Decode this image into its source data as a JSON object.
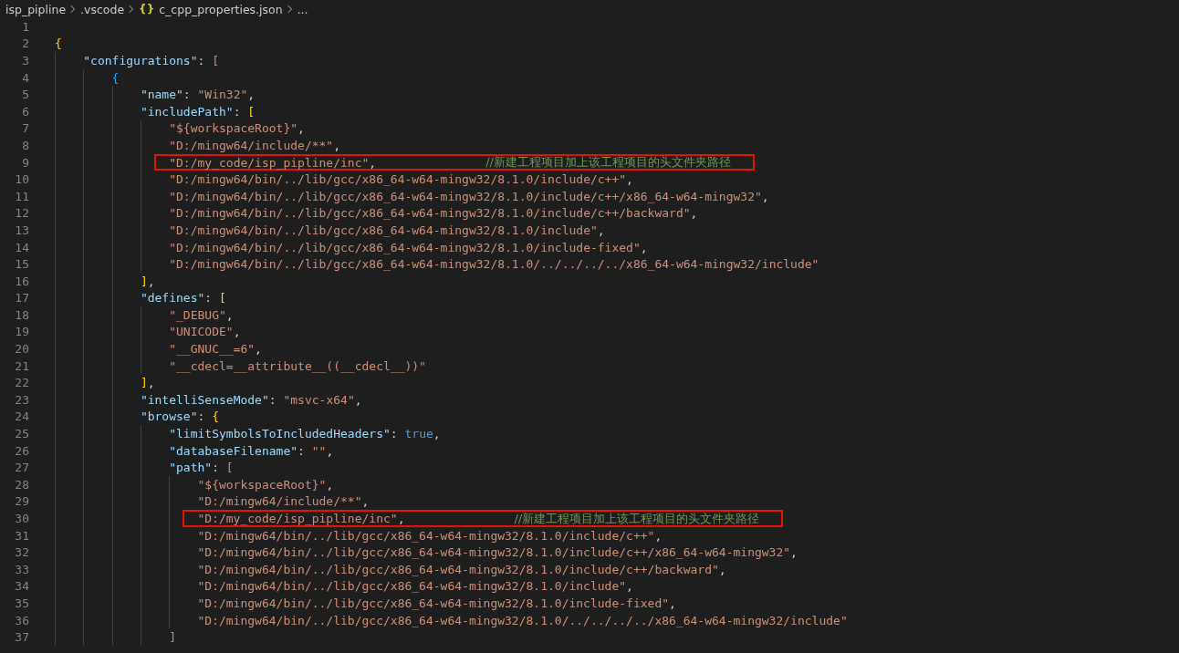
{
  "breadcrumb": {
    "folder": "isp_pipline",
    "subfolder": ".vscode",
    "file_icon": "{}",
    "file": "c_cpp_properties.json",
    "more": "..."
  },
  "lines": [
    {
      "n": "1"
    },
    {
      "n": "2",
      "tokens": [
        {
          "kind": "bracket",
          "text": "{"
        }
      ],
      "children": [
        {
          "n": "3",
          "tokens": [
            {
              "kind": "key",
              "text": "\"configurations\""
            },
            {
              "kind": "punct",
              "text": ": "
            },
            {
              "kind": "bracket",
              "text": "["
            }
          ],
          "children": [
            {
              "n": "4",
              "tokens": [
                {
                  "kind": "bracket",
                  "text": "{"
                }
              ],
              "children": [
                {
                  "n": "5",
                  "tokens": [
                    {
                      "kind": "key",
                      "text": "\"name\""
                    },
                    {
                      "kind": "punct",
                      "text": ": "
                    },
                    {
                      "kind": "string",
                      "text": "\"Win32\""
                    },
                    {
                      "kind": "punct",
                      "text": ","
                    }
                  ]
                },
                {
                  "n": "6",
                  "tokens": [
                    {
                      "kind": "key",
                      "text": "\"includePath\""
                    },
                    {
                      "kind": "punct",
                      "text": ": "
                    },
                    {
                      "kind": "bracket",
                      "text": "["
                    }
                  ],
                  "children": [
                    {
                      "n": "7",
                      "tokens": [
                        {
                          "kind": "string",
                          "text": "\"${workspaceRoot}\""
                        },
                        {
                          "kind": "punct",
                          "text": ","
                        }
                      ]
                    },
                    {
                      "n": "8",
                      "tokens": [
                        {
                          "kind": "string",
                          "text": "\"D:/mingw64/include/**\""
                        },
                        {
                          "kind": "punct",
                          "text": ","
                        }
                      ]
                    },
                    {
                      "n": "9",
                      "highlighted": true,
                      "tokens": [
                        {
                          "kind": "string",
                          "text": "\"D:/my_code/isp_pipline/inc\""
                        },
                        {
                          "kind": "punct",
                          "text": ","
                        }
                      ],
                      "comment": "//新建工程项目加上该工程项目的头文件夹路径"
                    },
                    {
                      "n": "10",
                      "tokens": [
                        {
                          "kind": "string",
                          "text": "\"D:/mingw64/bin/../lib/gcc/x86_64-w64-mingw32/8.1.0/include/c++\""
                        },
                        {
                          "kind": "punct",
                          "text": ","
                        }
                      ]
                    },
                    {
                      "n": "11",
                      "tokens": [
                        {
                          "kind": "string",
                          "text": "\"D:/mingw64/bin/../lib/gcc/x86_64-w64-mingw32/8.1.0/include/c++/x86_64-w64-mingw32\""
                        },
                        {
                          "kind": "punct",
                          "text": ","
                        }
                      ]
                    },
                    {
                      "n": "12",
                      "tokens": [
                        {
                          "kind": "string",
                          "text": "\"D:/mingw64/bin/../lib/gcc/x86_64-w64-mingw32/8.1.0/include/c++/backward\""
                        },
                        {
                          "kind": "punct",
                          "text": ","
                        }
                      ]
                    },
                    {
                      "n": "13",
                      "tokens": [
                        {
                          "kind": "string",
                          "text": "\"D:/mingw64/bin/../lib/gcc/x86_64-w64-mingw32/8.1.0/include\""
                        },
                        {
                          "kind": "punct",
                          "text": ","
                        }
                      ]
                    },
                    {
                      "n": "14",
                      "tokens": [
                        {
                          "kind": "string",
                          "text": "\"D:/mingw64/bin/../lib/gcc/x86_64-w64-mingw32/8.1.0/include-fixed\""
                        },
                        {
                          "kind": "punct",
                          "text": ","
                        }
                      ]
                    },
                    {
                      "n": "15",
                      "tokens": [
                        {
                          "kind": "string",
                          "text": "\"D:/mingw64/bin/../lib/gcc/x86_64-w64-mingw32/8.1.0/../../../../x86_64-w64-mingw32/include\""
                        }
                      ]
                    }
                  ]
                },
                {
                  "n": "16",
                  "tokens": [
                    {
                      "kind": "bracket",
                      "text": "]"
                    },
                    {
                      "kind": "punct",
                      "text": ","
                    }
                  ]
                },
                {
                  "n": "17",
                  "tokens": [
                    {
                      "kind": "key",
                      "text": "\"defines\""
                    },
                    {
                      "kind": "punct",
                      "text": ": "
                    },
                    {
                      "kind": "bracket",
                      "text": "["
                    }
                  ],
                  "children": [
                    {
                      "n": "18",
                      "tokens": [
                        {
                          "kind": "string",
                          "text": "\"_DEBUG\""
                        },
                        {
                          "kind": "punct",
                          "text": ","
                        }
                      ]
                    },
                    {
                      "n": "19",
                      "tokens": [
                        {
                          "kind": "string",
                          "text": "\"UNICODE\""
                        },
                        {
                          "kind": "punct",
                          "text": ","
                        }
                      ]
                    },
                    {
                      "n": "20",
                      "tokens": [
                        {
                          "kind": "string",
                          "text": "\"__GNUC__=6\""
                        },
                        {
                          "kind": "punct",
                          "text": ","
                        }
                      ]
                    },
                    {
                      "n": "21",
                      "tokens": [
                        {
                          "kind": "string",
                          "text": "\"__cdecl=__attribute__((__cdecl__))\""
                        }
                      ]
                    }
                  ]
                },
                {
                  "n": "22",
                  "tokens": [
                    {
                      "kind": "bracket",
                      "text": "]"
                    },
                    {
                      "kind": "punct",
                      "text": ","
                    }
                  ]
                },
                {
                  "n": "23",
                  "tokens": [
                    {
                      "kind": "key",
                      "text": "\"intelliSenseMode\""
                    },
                    {
                      "kind": "punct",
                      "text": ": "
                    },
                    {
                      "kind": "string",
                      "text": "\"msvc-x64\""
                    },
                    {
                      "kind": "punct",
                      "text": ","
                    }
                  ]
                },
                {
                  "n": "24",
                  "tokens": [
                    {
                      "kind": "key",
                      "text": "\"browse\""
                    },
                    {
                      "kind": "punct",
                      "text": ": "
                    },
                    {
                      "kind": "bracket",
                      "text": "{"
                    }
                  ],
                  "children": [
                    {
                      "n": "25",
                      "tokens": [
                        {
                          "kind": "key",
                          "text": "\"limitSymbolsToIncludedHeaders\""
                        },
                        {
                          "kind": "punct",
                          "text": ": "
                        },
                        {
                          "kind": "keyword",
                          "text": "true"
                        },
                        {
                          "kind": "punct",
                          "text": ","
                        }
                      ]
                    },
                    {
                      "n": "26",
                      "tokens": [
                        {
                          "kind": "key",
                          "text": "\"databaseFilename\""
                        },
                        {
                          "kind": "punct",
                          "text": ": "
                        },
                        {
                          "kind": "string",
                          "text": "\"\""
                        },
                        {
                          "kind": "punct",
                          "text": ","
                        }
                      ]
                    },
                    {
                      "n": "27",
                      "tokens": [
                        {
                          "kind": "key",
                          "text": "\"path\""
                        },
                        {
                          "kind": "punct",
                          "text": ": "
                        },
                        {
                          "kind": "bracket",
                          "text": "["
                        }
                      ],
                      "children": [
                        {
                          "n": "28",
                          "tokens": [
                            {
                              "kind": "string",
                              "text": "\"${workspaceRoot}\""
                            },
                            {
                              "kind": "punct",
                              "text": ","
                            }
                          ]
                        },
                        {
                          "n": "29",
                          "tokens": [
                            {
                              "kind": "string",
                              "text": "\"D:/mingw64/include/**\""
                            },
                            {
                              "kind": "punct",
                              "text": ","
                            }
                          ]
                        },
                        {
                          "n": "30",
                          "highlighted": true,
                          "tokens": [
                            {
                              "kind": "string",
                              "text": "\"D:/my_code/isp_pipline/inc\""
                            },
                            {
                              "kind": "punct",
                              "text": ","
                            }
                          ],
                          "comment": "//新建工程项目加上该工程项目的头文件夹路径"
                        },
                        {
                          "n": "31",
                          "tokens": [
                            {
                              "kind": "string",
                              "text": "\"D:/mingw64/bin/../lib/gcc/x86_64-w64-mingw32/8.1.0/include/c++\""
                            },
                            {
                              "kind": "punct",
                              "text": ","
                            }
                          ]
                        },
                        {
                          "n": "32",
                          "tokens": [
                            {
                              "kind": "string",
                              "text": "\"D:/mingw64/bin/../lib/gcc/x86_64-w64-mingw32/8.1.0/include/c++/x86_64-w64-mingw32\""
                            },
                            {
                              "kind": "punct",
                              "text": ","
                            }
                          ]
                        },
                        {
                          "n": "33",
                          "tokens": [
                            {
                              "kind": "string",
                              "text": "\"D:/mingw64/bin/../lib/gcc/x86_64-w64-mingw32/8.1.0/include/c++/backward\""
                            },
                            {
                              "kind": "punct",
                              "text": ","
                            }
                          ]
                        },
                        {
                          "n": "34",
                          "tokens": [
                            {
                              "kind": "string",
                              "text": "\"D:/mingw64/bin/../lib/gcc/x86_64-w64-mingw32/8.1.0/include\""
                            },
                            {
                              "kind": "punct",
                              "text": ","
                            }
                          ]
                        },
                        {
                          "n": "35",
                          "tokens": [
                            {
                              "kind": "string",
                              "text": "\"D:/mingw64/bin/../lib/gcc/x86_64-w64-mingw32/8.1.0/include-fixed\""
                            },
                            {
                              "kind": "punct",
                              "text": ","
                            }
                          ]
                        },
                        {
                          "n": "36",
                          "tokens": [
                            {
                              "kind": "string",
                              "text": "\"D:/mingw64/bin/../lib/gcc/x86_64-w64-mingw32/8.1.0/../../../../x86_64-w64-mingw32/include\""
                            }
                          ]
                        }
                      ]
                    },
                    {
                      "n": "37",
                      "tokens": [
                        {
                          "kind": "bracket",
                          "text": "]"
                        }
                      ]
                    }
                  ]
                }
              ]
            }
          ]
        }
      ]
    }
  ]
}
